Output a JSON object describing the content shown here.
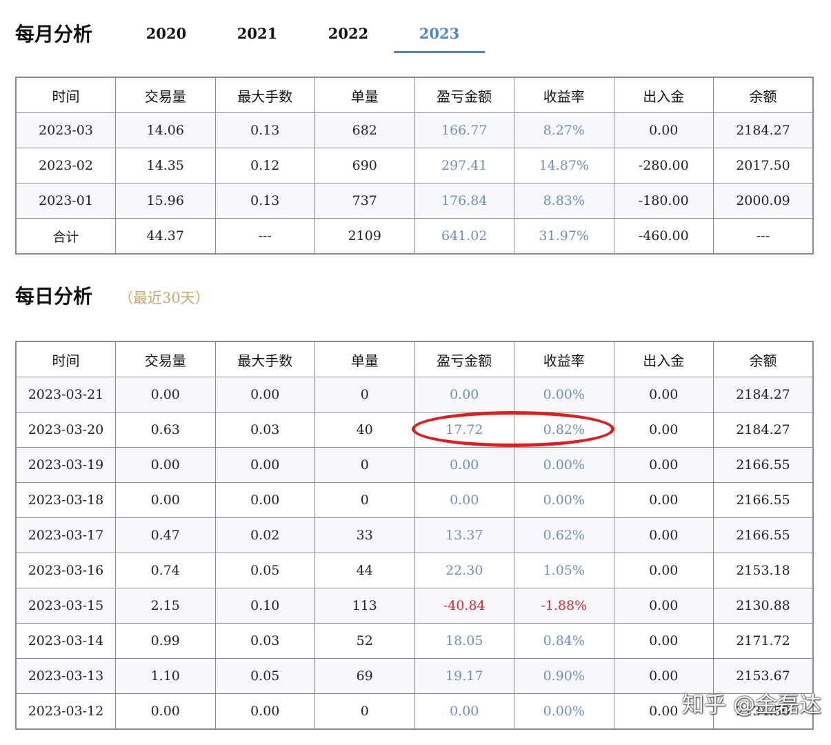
{
  "monthly": {
    "title": "每月分析",
    "tabs": [
      "2020",
      "2021",
      "2022",
      "2023"
    ],
    "active_tab": "2023",
    "accent_color": "#4f86c6",
    "columns": [
      "时间",
      "交易量",
      "最大手数",
      "单量",
      "盈亏金额",
      "收益率",
      "出入金",
      "余额"
    ],
    "rows": [
      [
        "2023-03",
        "14.06",
        "0.13",
        "682",
        "166.77",
        "8.27%",
        "0.00",
        "2184.27"
      ],
      [
        "2023-02",
        "14.35",
        "0.12",
        "690",
        "297.41",
        "14.87%",
        "-280.00",
        "2017.50"
      ],
      [
        "2023-01",
        "15.96",
        "0.13",
        "737",
        "176.84",
        "8.83%",
        "-180.00",
        "2000.09"
      ],
      [
        "合计",
        "44.37",
        "---",
        "2109",
        "641.02",
        "31.97%",
        "-460.00",
        "---"
      ]
    ]
  },
  "daily": {
    "title": "每日分析",
    "subtitle": "（最近30天）",
    "columns": [
      "时间",
      "交易量",
      "最大手数",
      "单量",
      "盈亏金额",
      "收益率",
      "出入金",
      "余额"
    ],
    "rows": [
      [
        "2023-03-21",
        "0.00",
        "0.00",
        "0",
        "0.00",
        "0.00%",
        "0.00",
        "2184.27"
      ],
      [
        "2023-03-20",
        "0.63",
        "0.03",
        "40",
        "17.72",
        "0.82%",
        "0.00",
        "2184.27"
      ],
      [
        "2023-03-19",
        "0.00",
        "0.00",
        "0",
        "0.00",
        "0.00%",
        "0.00",
        "2166.55"
      ],
      [
        "2023-03-18",
        "0.00",
        "0.00",
        "0",
        "0.00",
        "0.00%",
        "0.00",
        "2166.55"
      ],
      [
        "2023-03-17",
        "0.47",
        "0.02",
        "33",
        "13.37",
        "0.62%",
        "0.00",
        "2166.55"
      ],
      [
        "2023-03-16",
        "0.74",
        "0.05",
        "44",
        "22.30",
        "1.05%",
        "0.00",
        "2153.18"
      ],
      [
        "2023-03-15",
        "2.15",
        "0.10",
        "113",
        "-40.84",
        "-1.88%",
        "0.00",
        "2130.88"
      ],
      [
        "2023-03-14",
        "0.99",
        "0.03",
        "52",
        "18.05",
        "0.84%",
        "0.00",
        "2171.72"
      ],
      [
        "2023-03-13",
        "1.10",
        "0.05",
        "69",
        "19.17",
        "0.90%",
        "0.00",
        "2153.67"
      ],
      [
        "2023-03-12",
        "0.00",
        "0.00",
        "0",
        "0.00",
        "0.00%",
        "0.00",
        "2134.50"
      ]
    ]
  },
  "colors": {
    "profit": "#6f8fc4",
    "loss": "#d92b2b",
    "highlight": "#e21c1c",
    "subtitle": "#c8a96a"
  },
  "watermark": "知乎 @金磊达"
}
